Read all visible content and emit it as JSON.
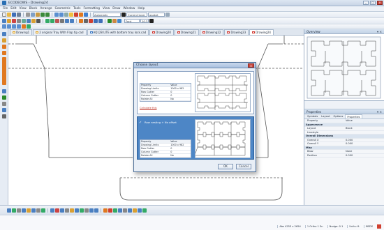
{
  "window": {
    "title": "ECODEOWS - Drawing24",
    "controls": [
      "_",
      "□",
      "×"
    ]
  },
  "menu": [
    "File",
    "Edit",
    "View",
    "Block",
    "Arrange",
    "Geometric",
    "Tools",
    "Formatting",
    "View",
    "Draw",
    "Window",
    "Help"
  ],
  "toolbar": {
    "zoom_value": "Automatic",
    "layer_value": "Current layer",
    "width_value": "gasket",
    "style_value": "Font",
    "size_value": "10.3"
  },
  "tabs": [
    {
      "label": "Drawing1",
      "active": false,
      "color": "#e0a020"
    },
    {
      "label": "2 original Tray With Flap tip.cad",
      "active": false,
      "color": "#e0a020"
    },
    {
      "label": "AQ128 LITE with bottom tray lock.cad",
      "active": false,
      "color": "#3a78c2"
    },
    {
      "label": "Drawing20",
      "active": false,
      "color": "#d0342c"
    },
    {
      "label": "Drawing21",
      "active": false,
      "color": "#d0342c"
    },
    {
      "label": "Drawing22",
      "active": false,
      "color": "#d0342c"
    },
    {
      "label": "Drawing23",
      "active": false,
      "color": "#d0342c"
    },
    {
      "label": "Drawing24",
      "active": true,
      "color": "#d0342c"
    }
  ],
  "overview": {
    "title": "Overview"
  },
  "properties": {
    "title": "Properties",
    "tabs": [
      "Symbols",
      "Layout",
      "Options",
      "Properties"
    ],
    "active_tab": "Properties",
    "header": {
      "k": "Property",
      "v": "Value"
    },
    "rows": [
      {
        "k": "Appearance",
        "v": "",
        "sec": true
      },
      {
        "k": "Layout",
        "v": "Block",
        "sec": false
      },
      {
        "k": "Linestyle",
        "v": "",
        "sec": false
      },
      {
        "k": "Overall Dimensions",
        "v": "",
        "sec": true
      },
      {
        "k": "Overall X",
        "v": "0.000",
        "sec": false
      },
      {
        "k": "Overall Y",
        "v": "0.000",
        "sec": false
      },
      {
        "k": "Misc",
        "v": "",
        "sec": true
      },
      {
        "k": "Blow",
        "v": "None",
        "sec": false
      },
      {
        "k": "Position",
        "v": "0.000",
        "sec": false
      }
    ]
  },
  "dialog": {
    "title": "Choose layout",
    "option1": {
      "header": {
        "k": "Property",
        "v": "Value"
      },
      "rows": [
        {
          "k": "Drawing Limits",
          "v": "1000 x 982"
        },
        {
          "k": "Row Gutter",
          "v": "0"
        },
        {
          "k": "Column Gutter",
          "v": "0"
        },
        {
          "k": "Rotate All",
          "v": "No"
        }
      ],
      "link": "Calculate this"
    },
    "option2": {
      "label": "Row nesting + No offset",
      "header": {
        "k": "Property",
        "v": "Value"
      },
      "rows": [
        {
          "k": "Drawing Limits",
          "v": "1000 x 982"
        },
        {
          "k": "Row Gutter",
          "v": "0"
        },
        {
          "k": "Column Gutter",
          "v": "0"
        },
        {
          "k": "Rotate All",
          "v": "No"
        }
      ]
    },
    "ok_label": "OK",
    "cancel_label": "Cancel"
  },
  "status": {
    "coords": "Abs 4253 x 2654",
    "snap": "1 Ortho 1 Sn",
    "nudge": "Nudge: 0.1",
    "units": "Units: ft",
    "zoom": "MSDS"
  }
}
